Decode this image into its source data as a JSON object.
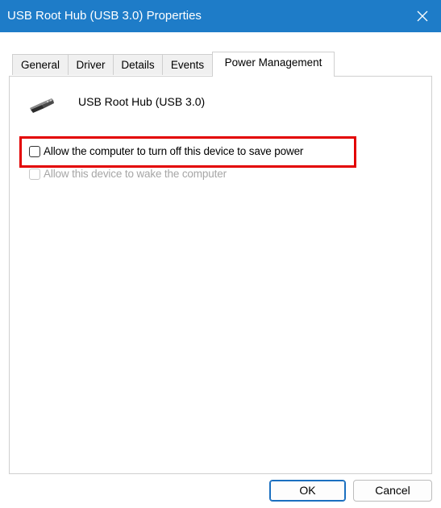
{
  "window": {
    "title": "USB Root Hub (USB 3.0) Properties",
    "accent_color": "#1e7cc8",
    "close_icon": "close-icon"
  },
  "tabs": [
    {
      "label": "General",
      "active": false
    },
    {
      "label": "Driver",
      "active": false
    },
    {
      "label": "Details",
      "active": false
    },
    {
      "label": "Events",
      "active": false
    },
    {
      "label": "Power Management",
      "active": true
    }
  ],
  "device": {
    "icon": "usb-connector-icon",
    "name": "USB Root Hub (USB 3.0)"
  },
  "options": [
    {
      "label": "Allow the computer to turn off this device to save power",
      "checked": false,
      "enabled": true
    },
    {
      "label": "Allow this device to wake the computer",
      "checked": false,
      "enabled": false
    }
  ],
  "annotation": {
    "color": "#e30000"
  },
  "buttons": {
    "ok": "OK",
    "cancel": "Cancel"
  }
}
